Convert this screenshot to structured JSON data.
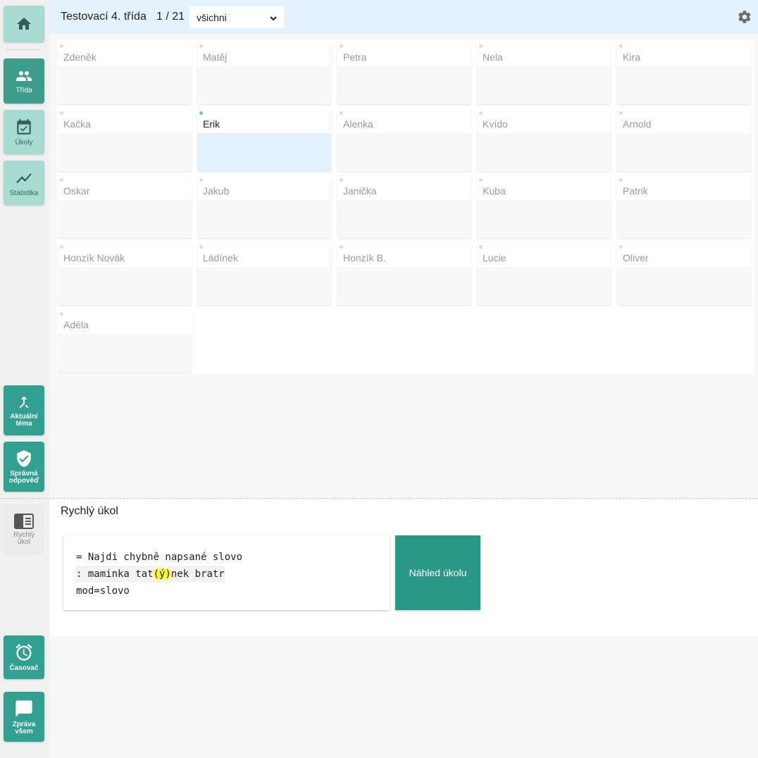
{
  "header": {
    "class_title": "Testovací 4. třída",
    "page_count": "1 / 21",
    "filter": {
      "selected": "všichni"
    },
    "settings_icon": "gear-icon"
  },
  "sidebar": {
    "home": {
      "icon": "home-icon"
    },
    "class": {
      "label": "Třída",
      "icon": "people-icon"
    },
    "tasks": {
      "label": "Úkoly",
      "icon": "calendar-check-icon"
    },
    "stats": {
      "label": "Statistika",
      "icon": "trend-line-icon"
    },
    "topic": {
      "label": "Aktuální téma",
      "icon": "merge-arrow-icon"
    },
    "answer": {
      "label": "Správná odpověď",
      "icon": "shield-check-icon"
    },
    "quick": {
      "label": "Rychlý úkol",
      "icon": "panel-icon"
    },
    "timer": {
      "label": "Časovač",
      "icon": "alarm-clock-icon"
    },
    "message": {
      "label": "Zpráva všem",
      "icon": "chat-icon"
    }
  },
  "students": [
    {
      "name": "Zdeněk",
      "active": false
    },
    {
      "name": "Matěj",
      "active": false
    },
    {
      "name": "Petra",
      "active": false
    },
    {
      "name": "Nela",
      "active": false
    },
    {
      "name": "Kira",
      "active": false
    },
    {
      "name": "Kačka",
      "active": false
    },
    {
      "name": "Erik",
      "active": true
    },
    {
      "name": "Alenka",
      "active": false
    },
    {
      "name": "Kvído",
      "active": false
    },
    {
      "name": "Arnold",
      "active": false
    },
    {
      "name": "Oskar",
      "active": false
    },
    {
      "name": "Jakub",
      "active": false
    },
    {
      "name": "Janička",
      "active": false
    },
    {
      "name": "Kuba",
      "active": false
    },
    {
      "name": "Patrik",
      "active": false
    },
    {
      "name": "Honzík Novák",
      "active": false
    },
    {
      "name": "Ládínek",
      "active": false
    },
    {
      "name": "Honzík B.",
      "active": false
    },
    {
      "name": "Lucie",
      "active": false
    },
    {
      "name": "Oliver",
      "active": false
    },
    {
      "name": "Adéla",
      "active": false
    }
  ],
  "quick_task": {
    "title": "Rychlý úkol",
    "line1": "= Najdi chybně napsané slovo",
    "line2_before": ": maminka tat",
    "line2_highlight": "(ý)",
    "line2_after": "nek bratr",
    "line3": "mod=slovo",
    "preview_label": "Náhled úkolu"
  },
  "colors": {
    "accent": "#2a9887",
    "header_bg": "#e3f2fc",
    "active_dot": "#5fd2ac",
    "highlight": "#fffb33"
  }
}
